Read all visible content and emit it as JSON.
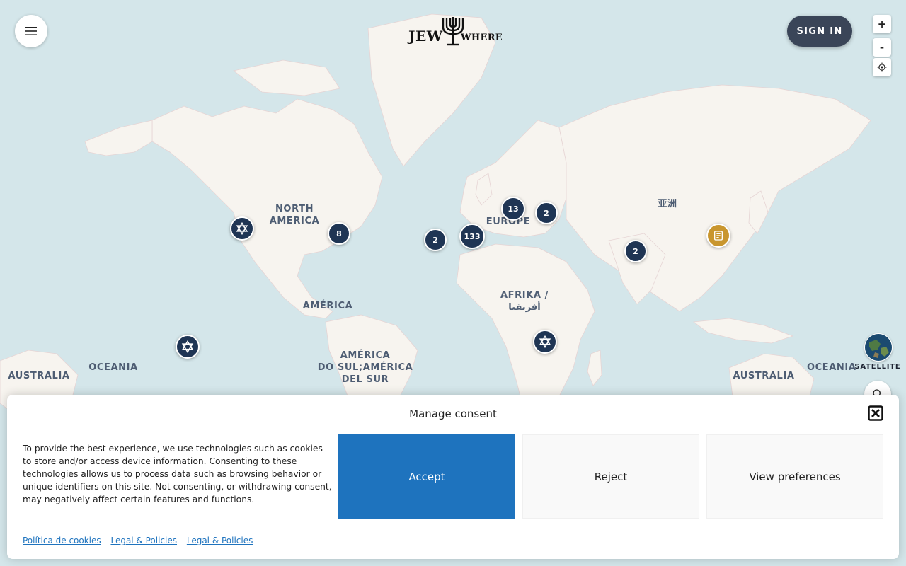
{
  "header": {
    "logo_text_left": "JEW",
    "logo_text_right": "WHERE",
    "sign_in_label": "SIGN IN",
    "menu_icon": "hamburger-icon"
  },
  "map_controls": {
    "zoom_in_label": "+",
    "zoom_out_label": "-",
    "locate_icon": "crosshair-icon",
    "satellite_label": "SATELLITE",
    "search_icon": "search-icon"
  },
  "map_labels": {
    "north_america": "NORTH\nAMERICA",
    "america": "AMÉRICA",
    "south_america": "AMÉRICA\nDO SUL;AMÉRICA\nDEL SUR",
    "europe": "EUROPE",
    "africa": "AFRIKA /\nأفريقيا",
    "asia": "亚洲",
    "australia_left": "AUSTRALIA",
    "oceania_left": "OCEANIA",
    "australia_right": "AUSTRALIA",
    "oceania_right": "OCEANIA"
  },
  "clusters": [
    {
      "count": "8"
    },
    {
      "count": "2"
    },
    {
      "count": "133"
    },
    {
      "count": "13"
    },
    {
      "count": "2"
    },
    {
      "count": "2"
    }
  ],
  "markers": {
    "star_icon": "star-of-david-icon",
    "book_icon": "book-icon"
  },
  "consent": {
    "title": "Manage consent",
    "text": "To provide the best experience, we use technologies such as cookies to store and/or access device information. Consenting to these technologies allows us to process data such as browsing behavior or unique identifiers on this site. Not consenting, or withdrawing consent, may negatively affect certain features and functions.",
    "accept_label": "Accept",
    "reject_label": "Reject",
    "preferences_label": "View preferences",
    "links": [
      "Política de cookies",
      "Legal & Policies",
      "Legal & Policies"
    ]
  },
  "colors": {
    "ocean": "#d4e6ea",
    "land": "#f7f4ef",
    "cluster": "#1f3554",
    "gold_marker": "#c9962e",
    "accept_button": "#1e73be",
    "sign_in_button": "#3a4558"
  }
}
